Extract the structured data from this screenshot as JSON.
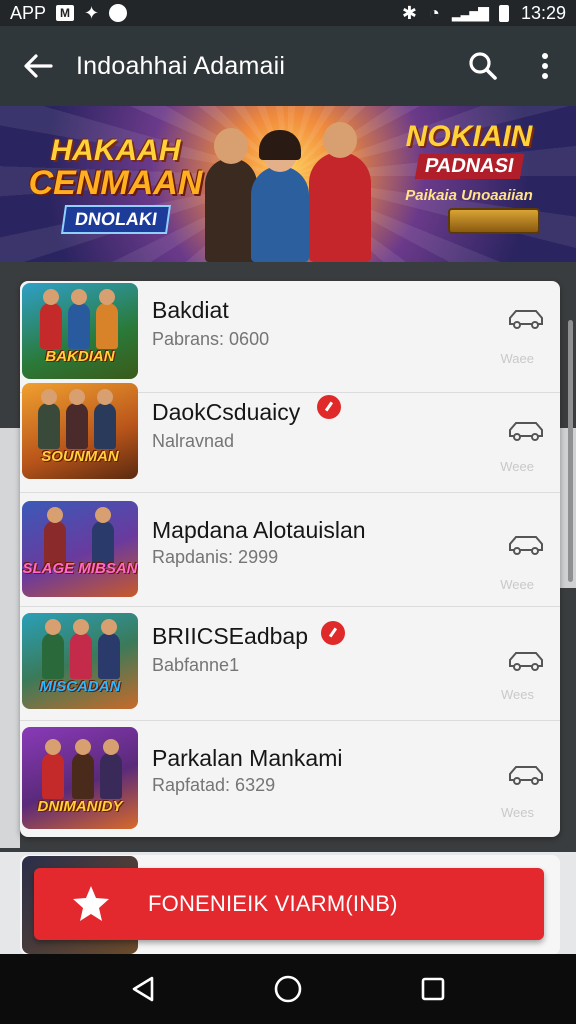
{
  "status_bar": {
    "carrier": "APP",
    "time": "13:29"
  },
  "app_bar": {
    "title": "Indoahhai Adamaii"
  },
  "banner": {
    "left_line1": "HAKAAH",
    "left_line2": "CENMAAN",
    "left_line3": "DNOLAKI",
    "right_line1": "NOKIAIN",
    "right_line2": "PADNASI",
    "right_line3": "Paikaia Unoaaiian"
  },
  "list": {
    "items": [
      {
        "name": "Bakdiat",
        "sub": "Pabrans: 0600",
        "faint": "Waee",
        "thumb_text": "BAKDIAN",
        "badge": false
      },
      {
        "name": "DaokCsduaicy",
        "sub": "Nalravnad",
        "faint": "Weee",
        "thumb_text": "SOUNMAN",
        "badge": true
      },
      {
        "name": "Mapdana Alotauislan",
        "sub": "Rapdanis: 2999",
        "faint": "Weee",
        "thumb_text": "SLAGE MIBSAN",
        "badge": false
      },
      {
        "name": "BRIICSEadbap",
        "sub": "Babfanne1",
        "faint": "Wees",
        "thumb_text": "MISCADAN",
        "badge": true
      },
      {
        "name": "Parkalan Mankami",
        "sub": "Rapfatad: 6329",
        "faint": "Wees",
        "thumb_text": "DNIMANIDY",
        "badge": false
      }
    ]
  },
  "cta": {
    "label": "FONENIEIK VIARM(INB)"
  },
  "colors": {
    "app_bar": "#30373a",
    "cta": "#e3282e",
    "badge": "#e02a2a"
  }
}
